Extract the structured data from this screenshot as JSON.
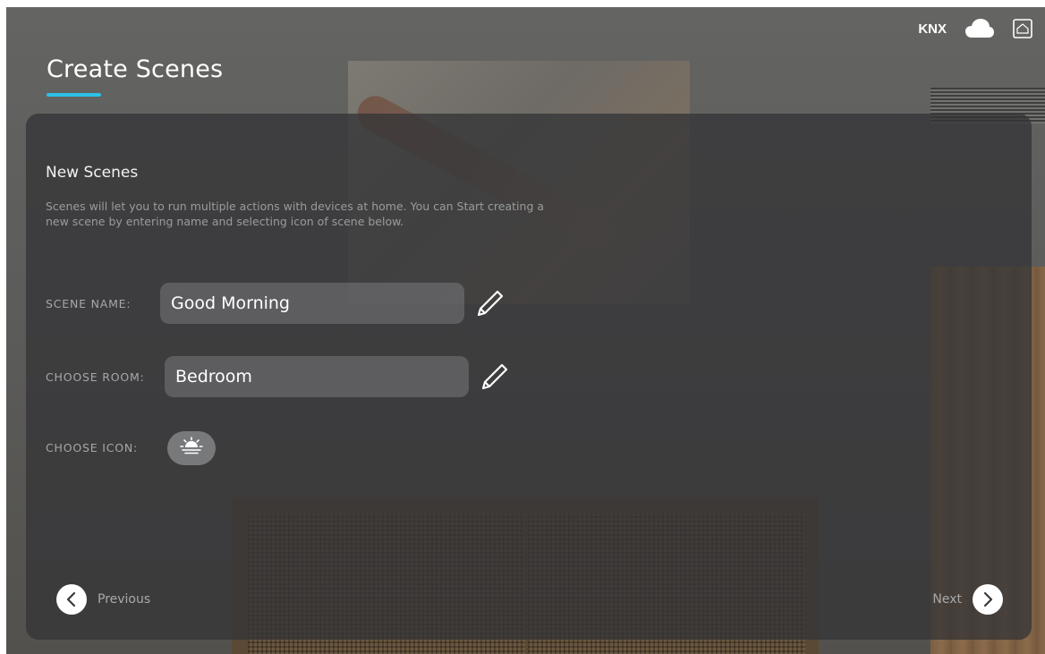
{
  "header": {
    "title": "Create Scenes",
    "knx_label": "KNX",
    "icons": [
      "cloud-icon",
      "home-icon"
    ]
  },
  "panel": {
    "heading": "New Scenes",
    "description": "Scenes will let you to run multiple actions with devices at home. You can Start creating a new scene by entering name and selecting icon of scene below.",
    "fields": {
      "scene_name": {
        "label": "SCENE NAME:",
        "value": "Good Morning"
      },
      "room": {
        "label": "CHOOSE ROOM:",
        "value": "Bedroom"
      },
      "icon": {
        "label": "CHOOSE ICON:",
        "selected_icon": "sunrise-icon"
      }
    }
  },
  "navigation": {
    "previous_label": "Previous",
    "next_label": "Next"
  },
  "colors": {
    "accent": "#2bc1e8",
    "panel": "#343537",
    "text_muted": "#a6a7a8"
  }
}
